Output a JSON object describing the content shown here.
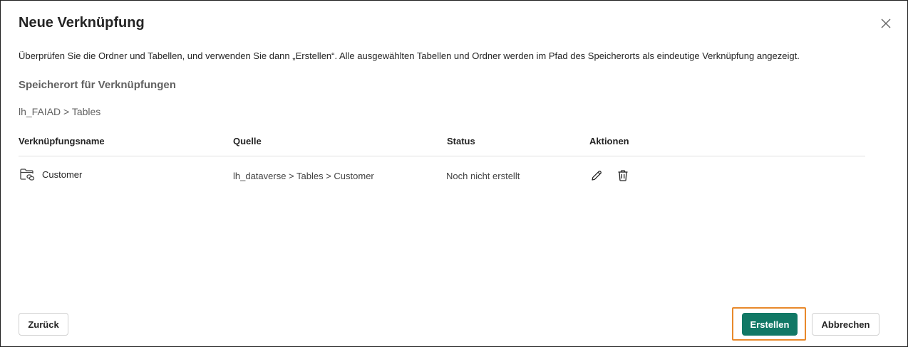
{
  "dialog": {
    "title": "Neue Verknüpfung",
    "description": "Überprüfen Sie die Ordner und Tabellen, und verwenden Sie dann „Erstellen“. Alle ausgewählten Tabellen und Ordner werden im Pfad des Speicherorts als eindeutige Verknüpfung angezeigt.",
    "section_heading": "Speicherort für Verknüpfungen",
    "breadcrumb": "lh_FAIAD > Tables",
    "close_icon": "close-icon"
  },
  "table": {
    "columns": [
      "Verknüpfungsname",
      "Quelle",
      "Status",
      "Aktionen"
    ],
    "rows": [
      {
        "icon": "folder-link-icon",
        "name": "Customer",
        "source": "lh_dataverse > Tables > Customer",
        "status": "Noch nicht erstellt",
        "actions": [
          "edit-icon",
          "delete-icon"
        ]
      }
    ]
  },
  "footer": {
    "back_label": "Zurück",
    "create_label": "Erstellen",
    "cancel_label": "Abbrechen"
  },
  "colors": {
    "primary": "#117865",
    "highlight": "#e8892b",
    "border": "#1f1f1f"
  }
}
